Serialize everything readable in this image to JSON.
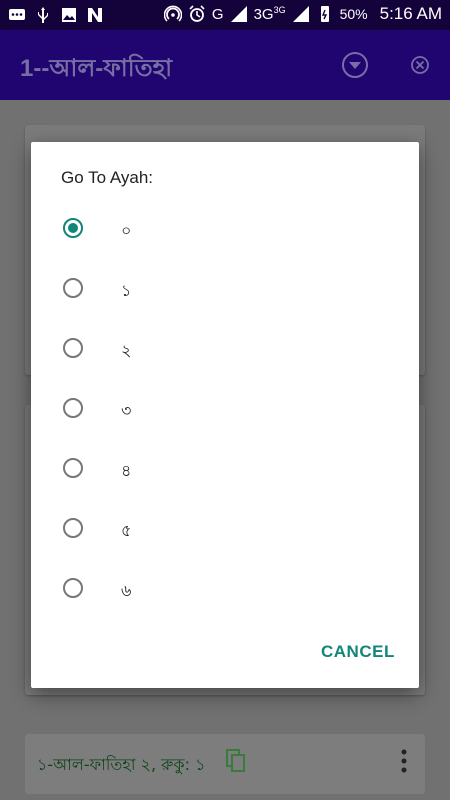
{
  "status_bar": {
    "battery": "50%",
    "time": "5:16 AM",
    "network_g": "G",
    "network_3g": "3G",
    "network_3g_sup": "3G"
  },
  "app_bar": {
    "title": "1--আল-ফাতিহা"
  },
  "background": {
    "bottom_card_text": "১-আল-ফাতিহা ২, রুকু: ১"
  },
  "dialog": {
    "title": "Go To Ayah:",
    "options": [
      "০",
      "১",
      "২",
      "৩",
      "৪",
      "৫",
      "৬"
    ],
    "selected_index": 0,
    "cancel_label": "CANCEL"
  },
  "colors": {
    "status_bar": "#14033a",
    "app_bar": "#200470",
    "accent": "#11857a"
  }
}
